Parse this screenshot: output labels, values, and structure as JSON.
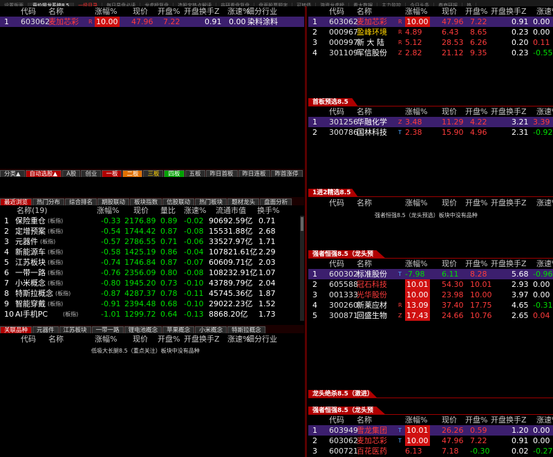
{
  "top_tabs": [
    "设置版面",
    "竞价狙龙系统8.5",
    "一级目录",
    "每日早盘必读",
    "龙虎榜复盘",
    "选股宝热点解读",
    "韭研看盘复盘",
    "盘面股票题字",
    "可转债",
    "游资龙虎榜",
    "看大数据",
    "主力监控",
    "今日头条",
    "券商研报",
    "热"
  ],
  "main_panel": {
    "headers": [
      "代码",
      "名称",
      "涨幅%",
      "现价",
      "开盘%",
      "开盘换手Z",
      "涨速%",
      "细分行业"
    ],
    "rows": [
      {
        "idx": "1",
        "code": "603062",
        "name": "麦加芯彩",
        "badge": "R",
        "change": "10.00",
        "price": "47.96",
        "open": "7.22",
        "turnover": "0.91",
        "speed": "0.00",
        "industry": "染料涂料"
      }
    ]
  },
  "right_top": {
    "headers": [
      "代码",
      "名称",
      "涨幅%",
      "现价",
      "开盘%",
      "开盘换手Z",
      "涨速%"
    ],
    "rows": [
      {
        "idx": "1",
        "code": "603062",
        "name": "麦加芯彩",
        "badge": "R",
        "change": "10.00",
        "price": "47.96",
        "open": "7.22",
        "turnover": "0.91",
        "speed": "0.00"
      },
      {
        "idx": "2",
        "code": "000967",
        "name": "盈峰环境",
        "badge": "R",
        "change": "4.89",
        "price": "6.43",
        "open": "8.65",
        "turnover": "0.23",
        "speed": "0.00"
      },
      {
        "idx": "3",
        "code": "000997",
        "name": "新 大 陆",
        "badge": "R",
        "change": "5.12",
        "price": "28.53",
        "open": "6.26",
        "turnover": "0.20",
        "speed": "0.11"
      },
      {
        "idx": "4",
        "code": "301109",
        "name": "军信股份",
        "badge": "Z",
        "change": "2.82",
        "price": "21.12",
        "open": "9.35",
        "turnover": "0.23",
        "speed": "-0.55"
      }
    ]
  },
  "first_board": {
    "title": "首板预选8.5",
    "headers": [
      "代码",
      "名称",
      "涨幅%",
      "现价",
      "开盘%",
      "开盘换手Z",
      "涨速%"
    ],
    "rows": [
      {
        "idx": "1",
        "code": "301256",
        "name": "华融化学",
        "badge": "Z",
        "change": "3.48",
        "price": "11.29",
        "open": "4.22",
        "turnover": "3.21",
        "speed": "3.39"
      },
      {
        "idx": "2",
        "code": "300786",
        "name": "国林科技",
        "badge": "T",
        "change": "2.38",
        "price": "15.90",
        "open": "4.96",
        "turnover": "2.31",
        "speed": "-0.92"
      }
    ]
  },
  "one_to_two": {
    "title": "1进2精选8.5",
    "headers": [
      "代码",
      "名称",
      "涨幅%",
      "现价",
      "开盘%",
      "开盘换手Z",
      "涨速%"
    ],
    "empty": "强者恒强8.5（龙头预选）板块中没有品种"
  },
  "strong_1": {
    "title": "强者恒强8.5（龙头预选）",
    "headers": [
      "代码",
      "名称",
      "涨幅%",
      "现价",
      "开盘%",
      "开盘换手Z",
      "涨速%"
    ],
    "rows": [
      {
        "idx": "1",
        "code": "600302",
        "name": "标准股份",
        "badge": "T",
        "change": "-7.98",
        "price": "6.11",
        "open": "8.28",
        "turnover": "5.68",
        "speed": "-0.96"
      },
      {
        "idx": "2",
        "code": "605588",
        "name": "冠石科技",
        "badge": "",
        "change": "10.01",
        "price": "54.30",
        "open": "10.01",
        "turnover": "2.93",
        "speed": "0.00"
      },
      {
        "idx": "3",
        "code": "001333",
        "name": "光华股份",
        "badge": "",
        "change": "10.00",
        "price": "23.98",
        "open": "10.00",
        "turnover": "3.97",
        "speed": "0.00"
      },
      {
        "idx": "4",
        "code": "300260",
        "name": "新莱应材",
        "badge": "R",
        "change": "13.09",
        "price": "37.40",
        "open": "17.75",
        "turnover": "4.65",
        "speed": "-0.31"
      },
      {
        "idx": "5",
        "code": "300871",
        "name": "回盛生物",
        "badge": "Z",
        "change": "17.43",
        "price": "24.66",
        "open": "10.76",
        "turnover": "2.65",
        "speed": "0.04"
      }
    ]
  },
  "dragon_kill": {
    "title": "龙头绝杀8.5（激进）"
  },
  "strong_2": {
    "title": "强者恒强8.5（龙头预选）",
    "headers": [
      "代码",
      "名称",
      "涨幅%",
      "现价",
      "开盘%",
      "开盘换手Z",
      "涨速%"
    ],
    "rows": [
      {
        "idx": "1",
        "code": "603949",
        "name": "雪龙集团",
        "badge": "T",
        "change": "10.01",
        "price": "26.26",
        "open": "0.59",
        "turnover": "1.20",
        "speed": "0.00"
      },
      {
        "idx": "2",
        "code": "603062",
        "name": "麦加芯彩",
        "badge": "T",
        "change": "10.00",
        "price": "47.96",
        "open": "7.22",
        "turnover": "0.91",
        "speed": "0.00"
      },
      {
        "idx": "3",
        "code": "600721",
        "name": "百花医药",
        "badge": "",
        "change": "6.13",
        "price": "7.18",
        "open": "-0.30",
        "turnover": "0.02",
        "speed": "-0.27"
      }
    ]
  },
  "strip1": [
    "分类▲",
    "自动选股▲",
    "A股",
    "创业",
    "一板",
    "二板",
    "三板",
    "四板",
    "五板",
    "昨日首板",
    "昨日连板",
    "昨首涨停"
  ],
  "strip2": [
    "最近浏览",
    "热门分布",
    "综合排名",
    "期股联动",
    "板块指数",
    "信股联动",
    "热门板块",
    "题材龙头",
    "盘面分析"
  ],
  "sector": {
    "headers": [
      "名称(19)",
      "涨幅%",
      "现价",
      "量比",
      "涨速%",
      "流通市值",
      "换手%"
    ],
    "rows": [
      {
        "idx": "1",
        "name": "保险重仓",
        "tag": "(板指)",
        "change": "-0.33",
        "price": "2176.89",
        "vol": "0.89",
        "speed": "-0.02",
        "cap": "90692.59亿",
        "turn": "0.71"
      },
      {
        "idx": "2",
        "name": "定增预案",
        "tag": "(板指)",
        "change": "-0.54",
        "price": "1744.42",
        "vol": "0.87",
        "speed": "-0.08",
        "cap": "15531.88亿",
        "turn": "2.68"
      },
      {
        "idx": "3",
        "name": "元器件",
        "tag": "(板指)",
        "change": "-0.57",
        "price": "2786.55",
        "vol": "0.71",
        "speed": "-0.06",
        "cap": "33527.97亿",
        "turn": "1.71"
      },
      {
        "idx": "4",
        "name": "新能源车",
        "tag": "(板指)",
        "change": "-0.58",
        "price": "1425.19",
        "vol": "0.86",
        "speed": "-0.04",
        "cap": "107821.61亿",
        "turn": "2.29"
      },
      {
        "idx": "5",
        "name": "江苏板块",
        "tag": "(板指)",
        "change": "-0.74",
        "price": "1746.84",
        "vol": "0.87",
        "speed": "-0.07",
        "cap": "60609.71亿",
        "turn": "2.03"
      },
      {
        "idx": "6",
        "name": "一带一路",
        "tag": "(板指)",
        "change": "-0.76",
        "price": "2356.09",
        "vol": "0.80",
        "speed": "-0.08",
        "cap": "108232.91亿",
        "turn": "1.07"
      },
      {
        "idx": "7",
        "name": "小米概念",
        "tag": "(板指)",
        "change": "-0.80",
        "price": "1945.20",
        "vol": "0.73",
        "speed": "-0.10",
        "cap": "43789.79亿",
        "turn": "2.04"
      },
      {
        "idx": "8",
        "name": "特斯拉概念",
        "tag": "(板指)",
        "change": "-0.87",
        "price": "4287.37",
        "vol": "0.78",
        "speed": "-0.11",
        "cap": "45745.36亿",
        "turn": "1.87"
      },
      {
        "idx": "9",
        "name": "智能穿戴",
        "tag": "(板指)",
        "change": "-0.91",
        "price": "2394.48",
        "vol": "0.68",
        "speed": "-0.10",
        "cap": "29022.23亿",
        "turn": "1.52"
      },
      {
        "idx": "10",
        "name": "AI手机PC",
        "tag": "(板指)",
        "change": "-1.01",
        "price": "1299.72",
        "vol": "0.64",
        "speed": "-0.13",
        "cap": "8868.20亿",
        "turn": "1.73"
      }
    ]
  },
  "strip3": [
    "关联品种",
    "元器件",
    "江苏板块",
    "一带一路",
    "锂电池概念",
    "苹果概念",
    "小米概念",
    "特斯拉概念"
  ],
  "related": {
    "headers": [
      "代码",
      "名称",
      "涨幅%",
      "现价",
      "开盘%",
      "开盘换手Z",
      "涨速%",
      "细分行业"
    ],
    "empty": "低吸大长腿8.5（重点关注）板块中没有品种"
  }
}
